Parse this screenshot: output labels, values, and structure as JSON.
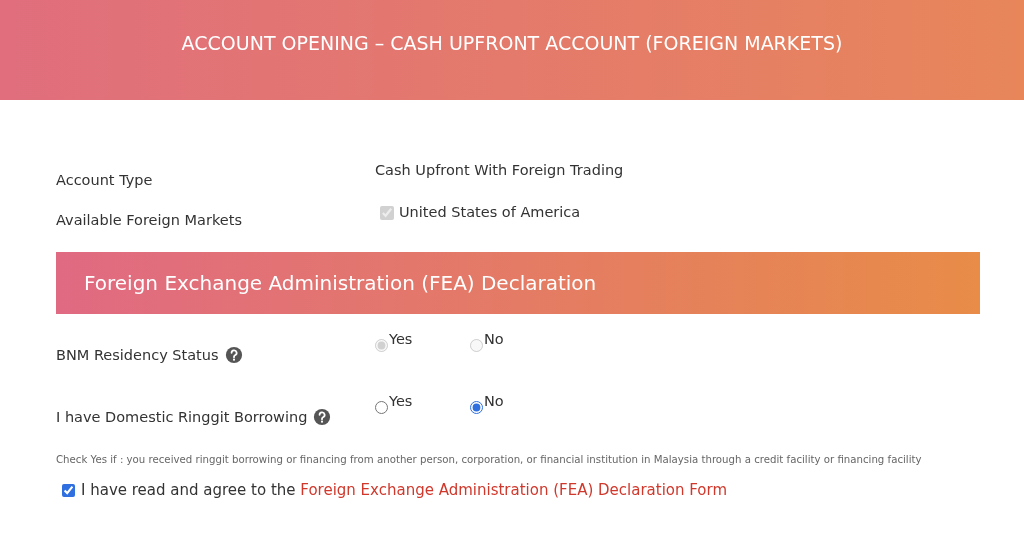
{
  "header": {
    "title": "ACCOUNT OPENING – CASH UPFRONT ACCOUNT (FOREIGN MARKETS)"
  },
  "account_type": {
    "label": "Account Type",
    "value": "Cash Upfront With Foreign Trading"
  },
  "available_markets": {
    "label": "Available Foreign Markets",
    "options": [
      {
        "label": "United States of America",
        "checked": true,
        "disabled": true
      }
    ]
  },
  "section": {
    "title": "Foreign Exchange Administration (FEA) Declaration"
  },
  "questions": [
    {
      "label": "BNM Residency Status",
      "help": true,
      "disabled": true,
      "options": [
        {
          "label": "Yes",
          "selected": true
        },
        {
          "label": "No",
          "selected": false
        }
      ]
    },
    {
      "label": "I have Domestic Ringgit Borrowing",
      "help": true,
      "disabled": false,
      "options": [
        {
          "label": "Yes",
          "selected": false
        },
        {
          "label": "No",
          "selected": true
        }
      ]
    }
  ],
  "hint": "Check Yes if : you received ringgit borrowing or financing from another person, corporation, or financial institution in Malaysia through a credit facility or financing facility",
  "agreement": {
    "checked": true,
    "text": "I have read and agree to the ",
    "link": "Foreign Exchange Administration (FEA) Declaration Form"
  }
}
